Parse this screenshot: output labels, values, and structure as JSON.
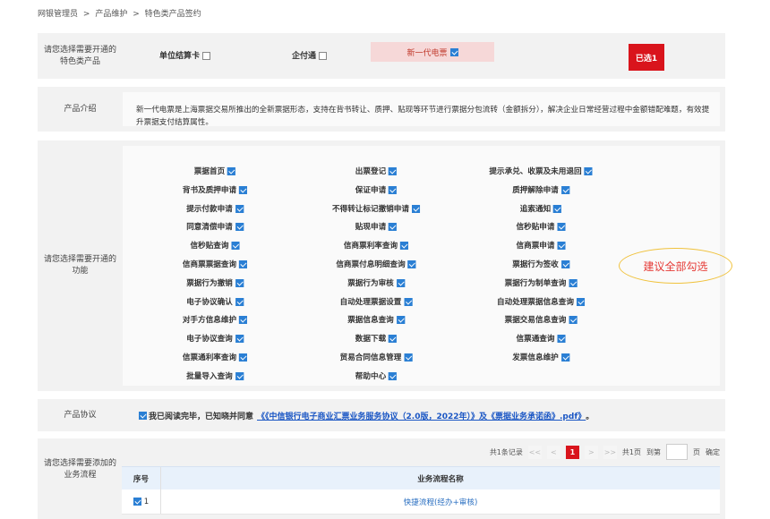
{
  "breadcrumb": [
    "网银管理员",
    ">",
    "产品维护",
    ">",
    "特色类产品签约"
  ],
  "product_select": {
    "label": "请您选择需要开通的特色类产品",
    "options": [
      {
        "name": "单位结算卡",
        "checked": false
      },
      {
        "name": "企付通",
        "checked": false
      },
      {
        "name": "新一代电票",
        "checked": true
      }
    ],
    "selected_label": "已选1"
  },
  "intro": {
    "label": "产品介绍",
    "text": "新一代电票是上海票据交易所推出的全新票据形态，支持在背书转让、质押、贴现等环节进行票据分包流转（金额拆分），解决企业日常经营过程中金额错配难题，有效提升票据支付结算属性。"
  },
  "features": {
    "label": "请您选择需要开通的功能",
    "columns": [
      [
        "票据首页",
        "背书及质押申请",
        "提示付款申请",
        "同意清偿申请",
        "信秒贴查询",
        "信商票票据查询",
        "票据行为撤销",
        "电子协议确认",
        "对手方信息维护",
        "电子协议查询",
        "信票通利率查询",
        "批量导入查询"
      ],
      [
        "出票登记",
        "保证申请",
        "不得转让标记撤销申请",
        "贴现申请",
        "信商票利率查询",
        "信商票付息明细查询",
        "票据行为审核",
        "自动处理票据设置",
        "票据信息查询",
        "数据下载",
        "贸易合同信息管理",
        "帮助中心"
      ],
      [
        "提示承兑、收票及未用退回",
        "质押解除申请",
        "追索通知",
        "信秒贴申请",
        "信商票申请",
        "票据行为签收",
        "票据行为制单查询",
        "自动处理票据信息查询",
        "票据交易信息查询",
        "信票通查询",
        "发票信息维护"
      ]
    ],
    "annotation": "建议全部勾选"
  },
  "agreement": {
    "label": "产品协议",
    "prefix": "我已阅读完毕，已知晓并同意",
    "link": "《《中信银行电子商业汇票业务服务协议（2.0版，2022年）》及《票据业务承诺函》.pdf》",
    "suffix": "。",
    "checked": true
  },
  "flows": {
    "label": "请您选择需要添加的业务流程",
    "pager": {
      "total": "共1条记录",
      "first": "<<",
      "prev": "<",
      "current": "1",
      "next": ">",
      "last": ">>",
      "pages": "共1页",
      "goto": "到第",
      "page_unit": "页",
      "confirm": "确定"
    },
    "headers": [
      "序号",
      "业务流程名称"
    ],
    "rows": [
      {
        "index": "1",
        "name": "快捷流程(经办+审核)",
        "checked": true
      }
    ]
  },
  "colors": {
    "accent_red": "#d9141c",
    "checkbox_blue": "#2a7fd4",
    "link_blue": "#1a56c4",
    "annotation_border": "#f0c23c",
    "annotation_text": "#e53935"
  }
}
